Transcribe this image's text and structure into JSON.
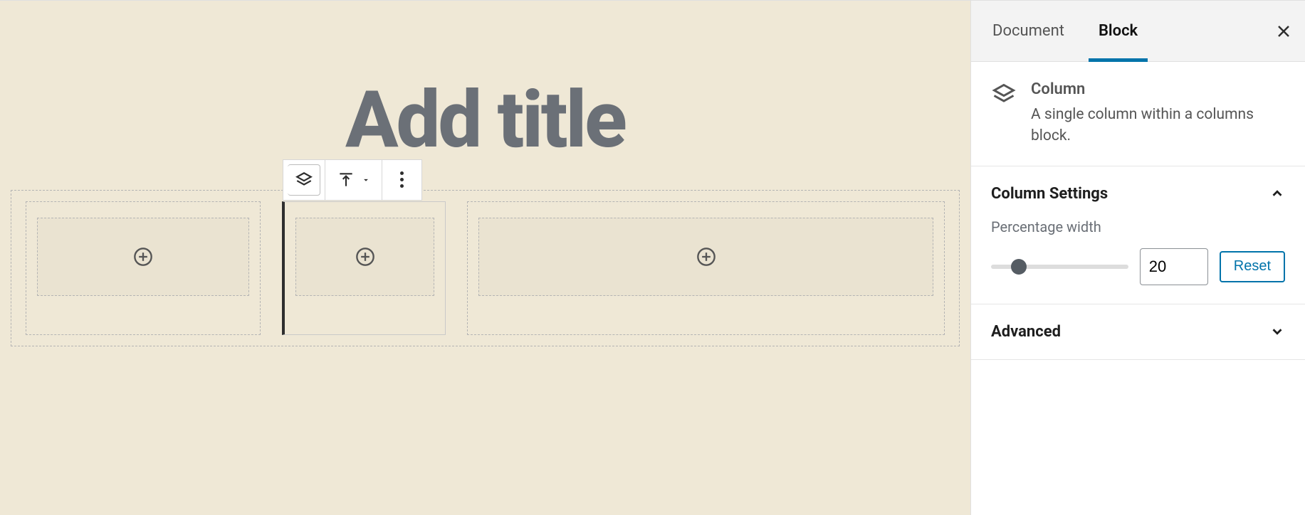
{
  "editor": {
    "title_placeholder": "Add title"
  },
  "sidebar": {
    "tabs": {
      "document": "Document",
      "block": "Block",
      "active": "block"
    },
    "block_info": {
      "name": "Column",
      "description": "A single column within a columns block."
    },
    "panels": {
      "column_settings": {
        "title": "Column Settings",
        "open": true,
        "width_label": "Percentage width",
        "width_value": "20",
        "reset_label": "Reset"
      },
      "advanced": {
        "title": "Advanced",
        "open": false
      }
    }
  }
}
